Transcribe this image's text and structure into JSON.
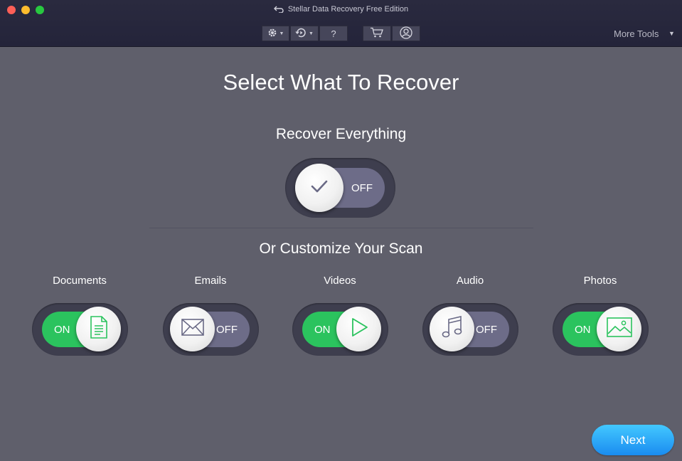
{
  "window": {
    "title": "Stellar Data Recovery Free Edition",
    "more_tools": "More Tools"
  },
  "toolbar": {
    "help_label": "?",
    "icons": [
      "gear-icon",
      "history-icon",
      "help-icon",
      "cart-icon",
      "account-icon"
    ]
  },
  "main": {
    "title": "Select What To Recover",
    "recover_everything": {
      "label": "Recover Everything",
      "state": "OFF",
      "icon": "checkmark-icon"
    },
    "customize_title": "Or Customize Your Scan",
    "categories": [
      {
        "label": "Documents",
        "state": "ON",
        "icon": "document-icon"
      },
      {
        "label": "Emails",
        "state": "OFF",
        "icon": "envelope-icon"
      },
      {
        "label": "Videos",
        "state": "ON",
        "icon": "play-icon"
      },
      {
        "label": "Audio",
        "state": "OFF",
        "icon": "music-note-icon"
      },
      {
        "label": "Photos",
        "state": "ON",
        "icon": "image-icon"
      }
    ],
    "next_label": "Next"
  },
  "colors": {
    "on": "#2bc35e",
    "off": "#6d6c88",
    "background": "#5f5f6b",
    "titlebar": "#2a2a3f",
    "accent": "#1a8cf0"
  }
}
